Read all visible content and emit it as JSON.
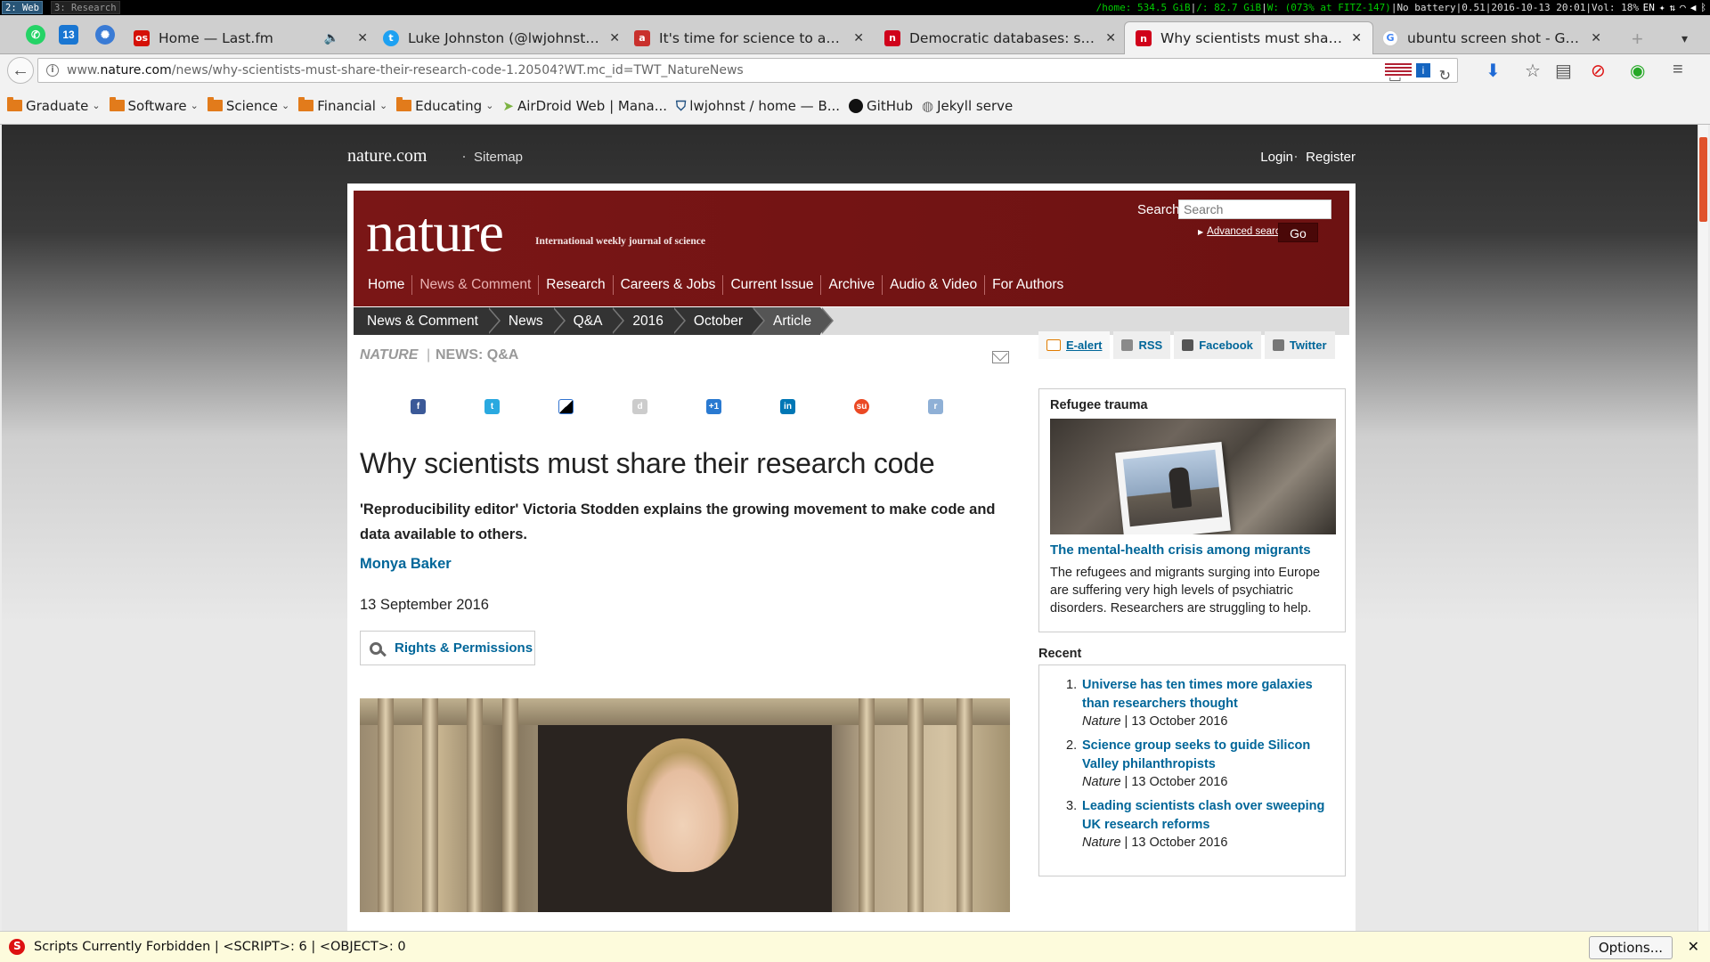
{
  "i3bar": {
    "workspaces": [
      "2: Web",
      "3: Research"
    ],
    "status_home": "/home: 534.5 GiB",
    "status_root": "/: 82.7 GiB",
    "status_wifi": "W: (073% at FITZ-147)",
    "status_battery": "No battery",
    "status_load": "0.51",
    "status_time": "2016-10-13 20:01",
    "status_vol": "Vol: 18%",
    "status_lang": "EN"
  },
  "tabs": [
    {
      "title": "Home — Last.fm",
      "fav_color": "#d51007",
      "fav_text": "os"
    },
    {
      "title": "Luke Johnston (@lwjohnst) | ...",
      "fav_color": "#1da1f2",
      "fav_text": "t"
    },
    {
      "title": "It's time for science to aband...",
      "fav_color": "#c9302c",
      "fav_text": "a"
    },
    {
      "title": "Democratic databases: scien...",
      "fav_color": "#d0021b",
      "fav_text": "n"
    },
    {
      "title": "Why scientists must share th...",
      "fav_color": "#d0021b",
      "fav_text": "n"
    },
    {
      "title": "ubuntu screen shot - Google ...",
      "fav_color": "#4285f4",
      "fav_text": "G"
    }
  ],
  "url": {
    "prefix": "www.",
    "domain": "nature.com",
    "path": "/news/why-scientists-must-share-their-research-code-1.20504?WT.mc_id=TWT_NatureNews"
  },
  "bookmarks": [
    {
      "label": "Graduate",
      "folder": true
    },
    {
      "label": "Software",
      "folder": true
    },
    {
      "label": "Science",
      "folder": true
    },
    {
      "label": "Financial",
      "folder": true
    },
    {
      "label": "Educating",
      "folder": true
    },
    {
      "label": "AirDroid Web | Mana...",
      "folder": false
    },
    {
      "label": "lwjohnst / home — B...",
      "folder": false
    },
    {
      "label": "GitHub",
      "folder": false
    },
    {
      "label": "Jekyll serve",
      "folder": false
    }
  ],
  "site": {
    "brand": "nature.com",
    "sitemap": "Sitemap",
    "login": "Login",
    "register": "Register"
  },
  "masthead": {
    "logo": "nature",
    "tagline": "International weekly journal of science",
    "search_label": "Search:",
    "search_placeholder": "Search",
    "advanced_search": "Advanced search",
    "go": "Go"
  },
  "mainnav": [
    "Home",
    "News & Comment",
    "Research",
    "Careers & Jobs",
    "Current Issue",
    "Archive",
    "Audio & Video",
    "For Authors"
  ],
  "breadcrumbs": [
    "News & Comment",
    "News",
    "Q&A",
    "2016",
    "October",
    "Article"
  ],
  "article": {
    "section_journal": "NATURE",
    "section_sep": "|",
    "section_type": "NEWS: Q&A",
    "headline": "Why scientists must share their research code",
    "standfirst": "'Reproducibility editor' Victoria Stodden explains the growing movement to make code and data available to others.",
    "author": "Monya Baker",
    "date": "13 September 2016",
    "rights": "Rights & Permissions"
  },
  "share_icons": [
    "facebook-icon",
    "twitter-icon",
    "delicious-icon",
    "digg-icon",
    "google-plus-icon",
    "linkedin-icon",
    "stumbleupon-icon",
    "reddit-icon"
  ],
  "sidebar": {
    "alerts": [
      "E-alert",
      "RSS",
      "Facebook",
      "Twitter"
    ],
    "feature": {
      "heading": "Refugee trauma",
      "link": "The mental-health crisis among migrants",
      "body": "The refugees and migrants surging into Europe are suffering very high levels of psychiatric disorders. Researchers are struggling to help."
    },
    "recent_heading": "Recent",
    "recent": [
      {
        "num": "1.",
        "title": "Universe has ten times more galaxies than researchers thought",
        "source": "Nature",
        "sep": " | ",
        "date": "13 October 2016"
      },
      {
        "num": "2.",
        "title": "Science group seeks to guide Silicon Valley philanthropists",
        "source": "Nature",
        "sep": " | ",
        "date": "13 October 2016"
      },
      {
        "num": "3.",
        "title": "Leading scientists clash over sweeping UK research reforms",
        "source": "Nature",
        "sep": " | ",
        "date": "13 October 2016"
      }
    ]
  },
  "noscript": {
    "message": "Scripts Currently Forbidden | <SCRIPT>: 6 | <OBJECT>: 0",
    "options": "Options...",
    "close": "✕"
  }
}
